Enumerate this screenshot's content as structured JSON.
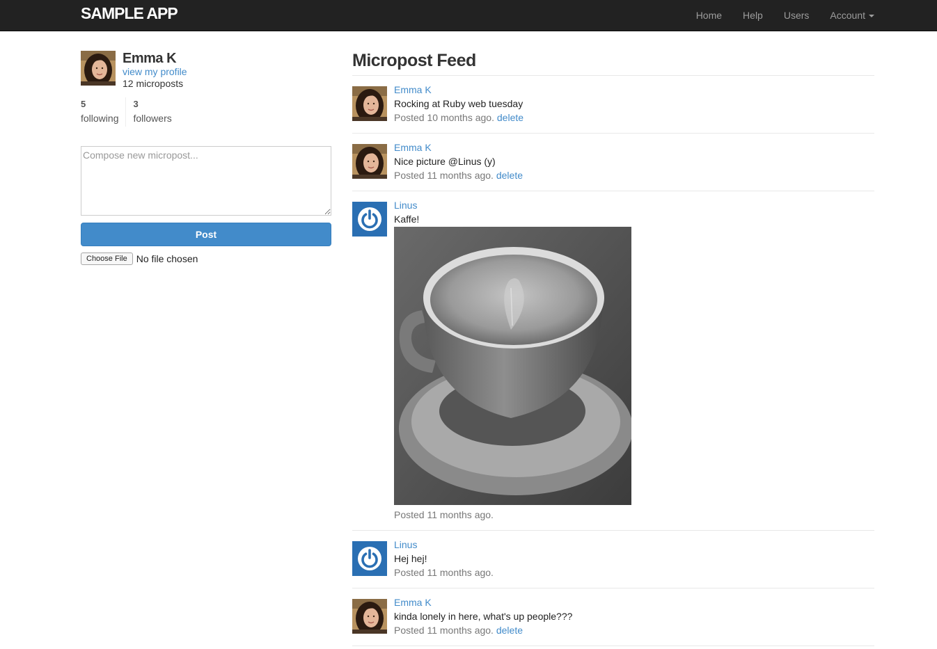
{
  "navbar": {
    "brand": "SAMPLE APP",
    "links": [
      "Home",
      "Help",
      "Users"
    ],
    "account_label": "Account"
  },
  "sidebar": {
    "user_name": "Emma K",
    "profile_link": "view my profile",
    "micropost_count": "12 microposts",
    "following_count": "5",
    "following_label": "following",
    "followers_count": "3",
    "followers_label": "followers",
    "compose_placeholder": "Compose new micropost...",
    "post_button": "Post",
    "file_button": "Choose File",
    "file_status": "No file chosen"
  },
  "feed": {
    "title": "Micropost Feed",
    "posts": [
      {
        "author": "Emma K",
        "avatar": "emma",
        "content": "Rocking at Ruby web tuesday",
        "time": "Posted 10 months ago.",
        "delete": "delete"
      },
      {
        "author": "Emma K",
        "avatar": "emma",
        "content": "Nice picture @Linus (y)",
        "time": "Posted 11 months ago.",
        "delete": "delete"
      },
      {
        "author": "Linus",
        "avatar": "power-icon",
        "content": "Kaffe!",
        "time": "Posted 11 months ago.",
        "image": "coffee-cup-photo"
      },
      {
        "author": "Linus",
        "avatar": "power-icon",
        "content": "Hej hej!",
        "time": "Posted 11 months ago."
      },
      {
        "author": "Emma K",
        "avatar": "emma",
        "content": "kinda lonely in here, what's up people???",
        "time": "Posted 11 months ago.",
        "delete": "delete"
      }
    ]
  },
  "colors": {
    "navbar_bg": "#222222",
    "link": "#428bca",
    "post_button": "#428bca",
    "linus_avatar": "#2a6fb3"
  }
}
